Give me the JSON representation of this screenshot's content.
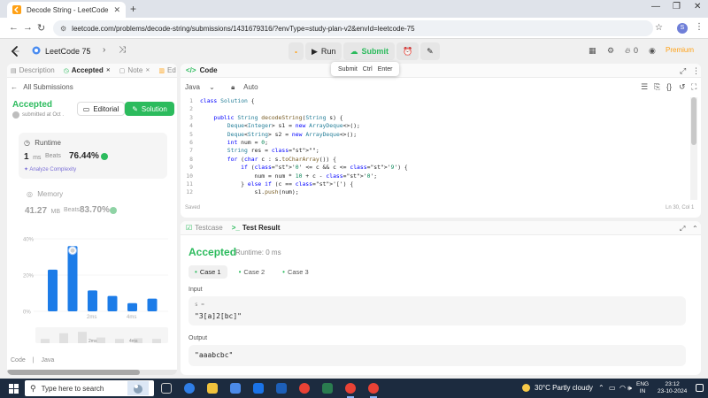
{
  "browser": {
    "tab_title": "Decode String - LeetCode",
    "url": "leetcode.com/problems/decode-string/submissions/1431679316/?envType=study-plan-v2&envId=leetcode-75",
    "profile_initial": "S"
  },
  "header": {
    "study_plan": "LeetCode 75",
    "run_label": "Run",
    "submit_label": "Submit",
    "tooltip": {
      "label": "Submit",
      "key1": "Ctrl",
      "key2": "Enter"
    },
    "streak": "0",
    "premium_label": "Premium"
  },
  "left": {
    "tabs": [
      {
        "label": "Description"
      },
      {
        "label": "Accepted",
        "close": "✕"
      },
      {
        "label": "Note",
        "close": "✕"
      },
      {
        "label": "Ed"
      }
    ],
    "back_label": "All Submissions",
    "status": "Accepted",
    "submitted": "submitted at Oct .",
    "editorial_label": "Editorial",
    "solution_label": "Solution",
    "runtime": {
      "label": "Runtime",
      "value": "1",
      "unit": "ms",
      "beats_label": "Beats",
      "beats": "76.44%",
      "analyze": "Analyze Complexity"
    },
    "memory": {
      "label": "Memory",
      "value": "41.27",
      "unit": "MB",
      "beats_label": "Beats",
      "beats": "83.70%"
    },
    "footer": {
      "code_label": "Code",
      "lang": "Java"
    }
  },
  "chart_data": {
    "type": "bar",
    "y_ticks": [
      "40%",
      "20%",
      "0%"
    ],
    "ylim": [
      0,
      40
    ],
    "x_tick_labels": [
      "2ms",
      "4ms"
    ],
    "values": [
      23,
      36,
      11.5,
      8.5,
      4.5,
      7
    ],
    "highlight_index": 1,
    "bar_color": "#1c7ce8",
    "mini_values": [
      3,
      7,
      8,
      4,
      3,
      3.5,
      3
    ],
    "mini_tick_labels": [
      "2ms",
      "4ms"
    ]
  },
  "code_panel": {
    "title": "Code",
    "lang": "Java",
    "mode": "Auto",
    "saved": "Saved",
    "cursor": "Ln 30, Col 1",
    "lines": [
      "class Solution {",
      "",
      "    public String decodeString(String s) {",
      "        Deque<Integer> s1 = new ArrayDeque<>();",
      "        Deque<String> s2 = new ArrayDeque<>();",
      "        int num = 0;",
      "        String res = \"\";",
      "        for (char c : s.toCharArray()) {",
      "            if ('0' <= c && c <= '9') {",
      "                num = num * 10 + c - '0';",
      "            } else if (c == '[') {",
      "                s1.push(num);"
    ]
  },
  "result_panel": {
    "tabs": [
      {
        "label": "Testcase"
      },
      {
        "label": "Test Result"
      }
    ],
    "status": "Accepted",
    "runtime": "Runtime: 0 ms",
    "cases": [
      "Case 1",
      "Case 2",
      "Case 3"
    ],
    "input_label": "Input",
    "input_var": "s =",
    "input_value": "\"3[a]2[bc]\"",
    "output_label": "Output",
    "output_value": "\"aaabcbc\""
  },
  "taskbar": {
    "search_placeholder": "Type here to search",
    "weather": "30°C  Partly cloudy",
    "lang_line1": "ENG",
    "lang_line2": "IN",
    "time": "23:12",
    "date": "23-10-2024"
  }
}
